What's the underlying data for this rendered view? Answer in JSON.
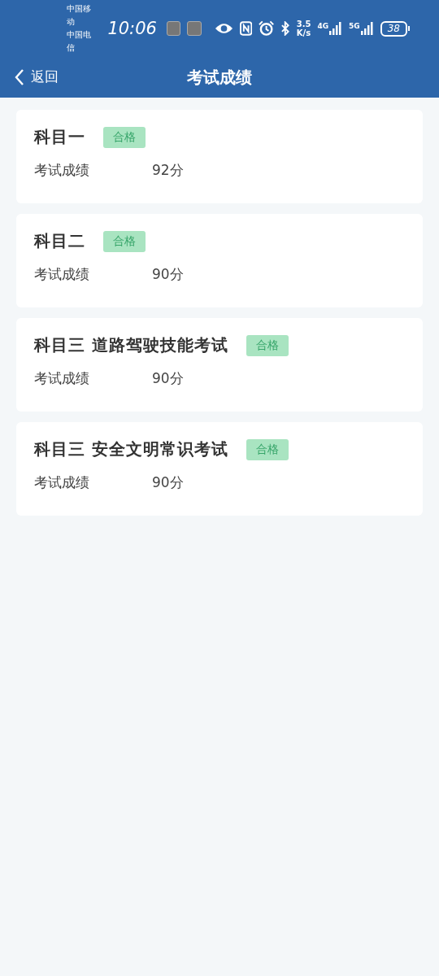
{
  "status_bar": {
    "carriers": [
      "中国移动",
      "中国电信"
    ],
    "time": "10:06",
    "speed": [
      "3.5",
      "K/s"
    ],
    "networks": [
      "4G",
      "5G"
    ],
    "battery": "38"
  },
  "header": {
    "back": "返回",
    "title": "考试成绩"
  },
  "results": [
    {
      "subject": "科目一",
      "tag": "合格",
      "label": "考试成绩",
      "score": "92分"
    },
    {
      "subject": "科目二",
      "tag": "合格",
      "label": "考试成绩",
      "score": "90分"
    },
    {
      "subject": "科目三 道路驾驶技能考试",
      "tag": "合格",
      "label": "考试成绩",
      "score": "90分"
    },
    {
      "subject": "科目三 安全文明常识考试",
      "tag": "合格",
      "label": "考试成绩",
      "score": "90分"
    }
  ]
}
